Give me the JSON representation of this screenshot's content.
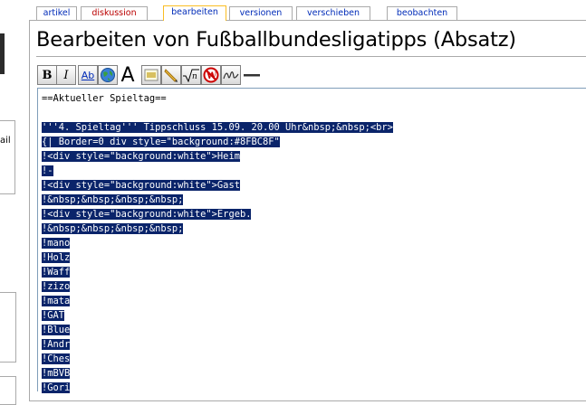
{
  "tabs": {
    "article": "artikel",
    "discussion": "diskussion",
    "edit": "bearbeiten",
    "history": "versionen",
    "move": "verschieben",
    "watch": "beobachten"
  },
  "page": {
    "title": "Bearbeiten von Fußballbundesligatipps (Absatz)"
  },
  "sidebar": {
    "email_fragment": "ail"
  },
  "toolbar": {
    "bold": "B",
    "italic": "I",
    "link": "Ab",
    "big_a": "A"
  },
  "editor": {
    "lines": [
      {
        "text": "==Aktueller Spieltag==",
        "selected": false
      },
      {
        "text": "",
        "selected": false
      },
      {
        "text": "'''4. Spieltag''' Tippschluss 15.09. 20.00 Uhr&nbsp;&nbsp;<br>",
        "selected": true
      },
      {
        "text": "{| Border=0 div style=\"background:#8FBC8F\"",
        "selected": true
      },
      {
        "text": "!<div style=\"background:white\">Heim",
        "selected": true
      },
      {
        "text": "!-",
        "selected": true
      },
      {
        "text": "!<div style=\"background:white\">Gast",
        "selected": true
      },
      {
        "text": "!&nbsp;&nbsp;&nbsp;&nbsp;",
        "selected": true
      },
      {
        "text": "!<div style=\"background:white\">Ergeb.",
        "selected": true
      },
      {
        "text": "!&nbsp;&nbsp;&nbsp;&nbsp;",
        "selected": true
      },
      {
        "text": "!mano",
        "selected": true
      },
      {
        "text": "!Holz",
        "selected": true
      },
      {
        "text": "!Waff",
        "selected": true
      },
      {
        "text": "!zizo",
        "selected": true
      },
      {
        "text": "!mata",
        "selected": true
      },
      {
        "text": "!GAT",
        "selected": true
      },
      {
        "text": "!Blue",
        "selected": true
      },
      {
        "text": "!Andr",
        "selected": true
      },
      {
        "text": "!Ches",
        "selected": true
      },
      {
        "text": "!mBVB",
        "selected": true
      },
      {
        "text": "!Gori",
        "selected": true
      }
    ]
  }
}
